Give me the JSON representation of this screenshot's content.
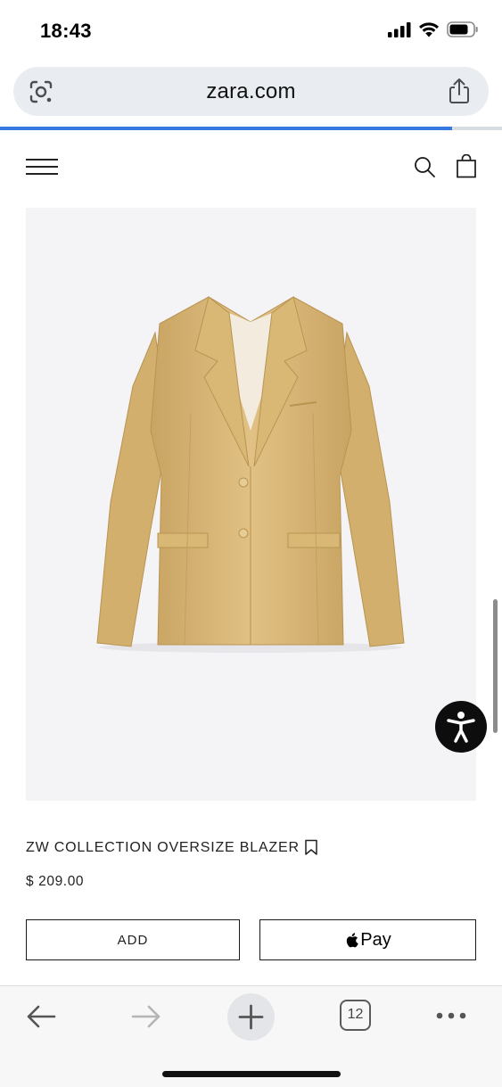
{
  "status_bar": {
    "time": "18:43",
    "icons": [
      "cellular-signal-icon",
      "wifi-icon",
      "battery-icon"
    ]
  },
  "browser": {
    "url": "zara.com",
    "left_icon": "google-lens-icon",
    "right_icon": "share-icon",
    "load_progress": 0.9,
    "accent_color": "#3478e0"
  },
  "site_header": {
    "left_icon": "menu-icon",
    "right_icons": [
      "search-icon",
      "shopping-bag-icon"
    ]
  },
  "product": {
    "image_subject": "beige blazer",
    "name": "ZW COLLECTION OVERSIZE BLAZER",
    "price": "$ 209.00",
    "bookmark_icon": "bookmark-icon",
    "add_button_label": "ADD",
    "pay_button_label": "Pay",
    "pay_icon": "apple-logo-icon"
  },
  "accessibility": {
    "icon": "accessibility-icon"
  },
  "toolbar": {
    "tab_count": "12",
    "icons": [
      "back-arrow-icon",
      "forward-arrow-icon",
      "new-tab-plus-icon",
      "tabs-icon",
      "more-dots-icon"
    ]
  }
}
